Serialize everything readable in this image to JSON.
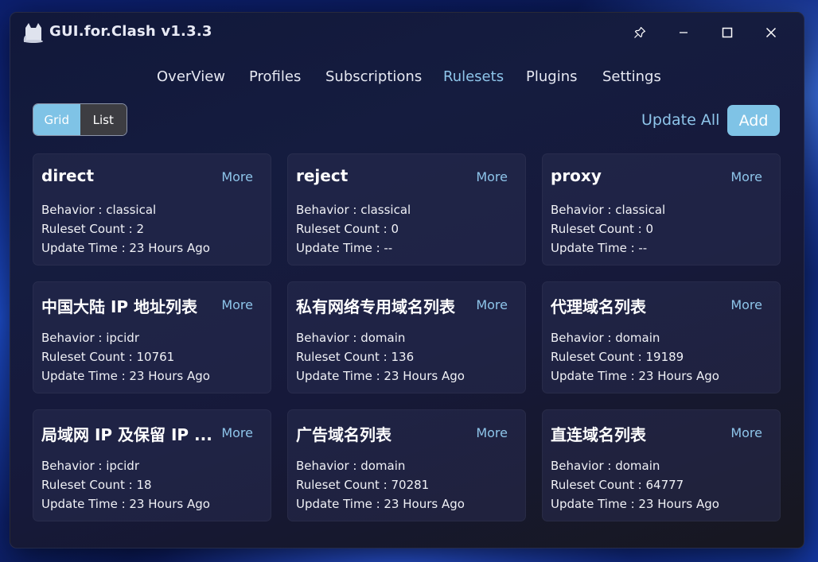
{
  "window": {
    "title": "GUI.for.Clash v1.3.3"
  },
  "nav": {
    "tabs": [
      {
        "label": "OverView"
      },
      {
        "label": "Profiles"
      },
      {
        "label": "Subscriptions"
      },
      {
        "label": "Rulesets"
      },
      {
        "label": "Plugins"
      },
      {
        "label": "Settings"
      }
    ],
    "active": "Rulesets"
  },
  "view_toggle": {
    "grid": "Grid",
    "list": "List",
    "selected": "Grid"
  },
  "toolbar": {
    "update_all": "Update All",
    "add": "Add"
  },
  "labels": {
    "more": "More"
  },
  "cards": [
    {
      "name": "direct",
      "behavior": "Behavior : classical",
      "count": "Ruleset Count : 2",
      "updated": "Update Time : 23 Hours Ago"
    },
    {
      "name": "reject",
      "behavior": "Behavior : classical",
      "count": "Ruleset Count : 0",
      "updated": "Update Time : --"
    },
    {
      "name": "proxy",
      "behavior": "Behavior : classical",
      "count": "Ruleset Count : 0",
      "updated": "Update Time : --"
    },
    {
      "name": "中国大陆 IP 地址列表",
      "behavior": "Behavior : ipcidr",
      "count": "Ruleset Count : 10761",
      "updated": "Update Time : 23 Hours Ago"
    },
    {
      "name": "私有网络专用域名列表",
      "behavior": "Behavior : domain",
      "count": "Ruleset Count : 136",
      "updated": "Update Time : 23 Hours Ago"
    },
    {
      "name": "代理域名列表",
      "behavior": "Behavior : domain",
      "count": "Ruleset Count : 19189",
      "updated": "Update Time : 23 Hours Ago"
    },
    {
      "name": "局域网 IP 及保留 IP ...",
      "behavior": "Behavior : ipcidr",
      "count": "Ruleset Count : 18",
      "updated": "Update Time : 23 Hours Ago"
    },
    {
      "name": "广告域名列表",
      "behavior": "Behavior : domain",
      "count": "Ruleset Count : 70281",
      "updated": "Update Time : 23 Hours Ago"
    },
    {
      "name": "直连域名列表",
      "behavior": "Behavior : domain",
      "count": "Ruleset Count : 64777",
      "updated": "Update Time : 23 Hours Ago"
    }
  ],
  "colors": {
    "accent": "#7fc3e6",
    "link": "#8ec5ea",
    "card_bg": "#282c4e"
  },
  "icons": {
    "logo": "cat-logo-icon",
    "pin": "pin-icon",
    "minimize": "minimize-icon",
    "maximize": "maximize-icon",
    "close": "close-icon"
  }
}
